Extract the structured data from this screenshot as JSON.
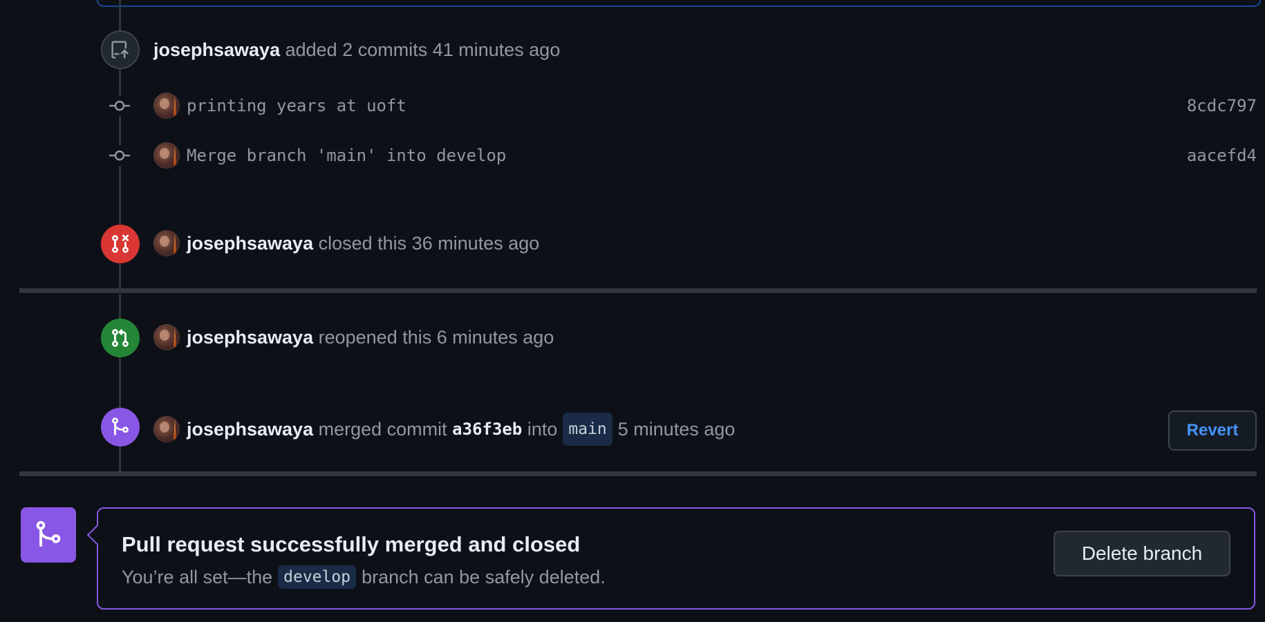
{
  "timeline": {
    "commits_event": {
      "user": "josephsawaya",
      "text": "added 2 commits 41 minutes ago",
      "icon": "repo-push-icon"
    },
    "commits": [
      {
        "message": "printing years at uoft",
        "sha": "8cdc797"
      },
      {
        "message": "Merge branch 'main' into develop",
        "sha": "aacefd4"
      }
    ],
    "closed_event": {
      "user": "josephsawaya",
      "text": "closed this 36 minutes ago",
      "icon": "git-pull-request-closed-icon",
      "color": "#da3633"
    },
    "reopened_event": {
      "user": "josephsawaya",
      "text": "reopened this 6 minutes ago",
      "icon": "git-pull-request-icon",
      "color": "#238636"
    },
    "merged_event": {
      "user": "josephsawaya",
      "text_before": "merged commit",
      "commit": "a36f3eb",
      "text_into": "into",
      "branch": "main",
      "text_after": "5 minutes ago",
      "icon": "git-merge-icon",
      "color": "#8957e5",
      "revert_label": "Revert"
    }
  },
  "merge_box": {
    "icon": "git-merge-icon",
    "title": "Pull request successfully merged and closed",
    "desc_before": "You’re all set—the",
    "branch": "develop",
    "desc_after": "branch can be safely deleted.",
    "delete_label": "Delete branch",
    "accent_color": "#8957e5"
  }
}
